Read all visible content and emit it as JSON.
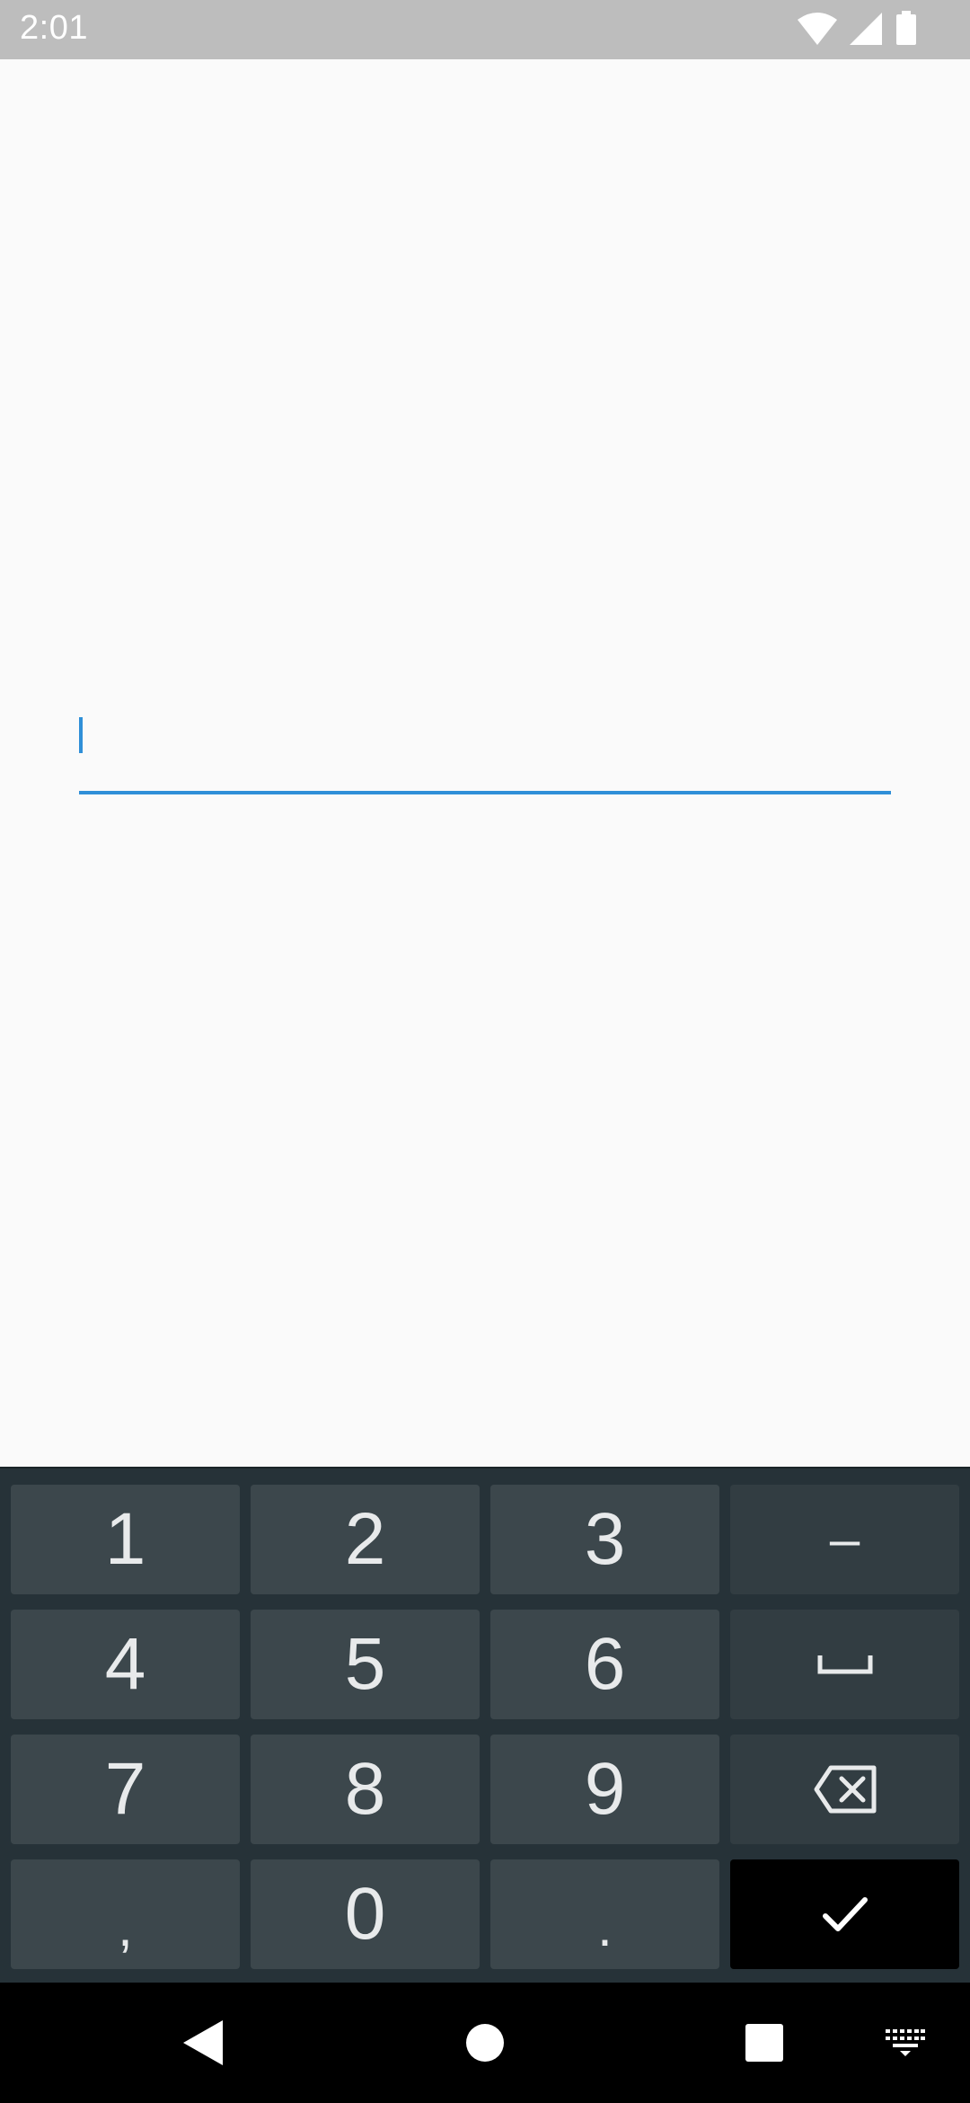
{
  "status_bar": {
    "time": "2:01",
    "icons": [
      "wifi-icon",
      "signal-icon",
      "battery-icon"
    ]
  },
  "text_field": {
    "value": "",
    "accent_color": "#2f8fd8"
  },
  "keyboard": {
    "rows": [
      [
        "1",
        "2",
        "3",
        "–"
      ],
      [
        "4",
        "5",
        "6",
        "space-icon"
      ],
      [
        "7",
        "8",
        "9",
        "backspace-icon"
      ],
      [
        ",",
        "0",
        ".",
        "check-icon"
      ]
    ],
    "keys": {
      "k1": "1",
      "k2": "2",
      "k3": "3",
      "dash": "–",
      "k4": "4",
      "k5": "5",
      "k6": "6",
      "k7": "7",
      "k8": "8",
      "k9": "9",
      "comma": ",",
      "k0": "0",
      "period": "."
    }
  },
  "nav_bar": {
    "icons": [
      "back-icon",
      "home-icon",
      "recents-icon",
      "keyboard-switch-icon"
    ]
  }
}
